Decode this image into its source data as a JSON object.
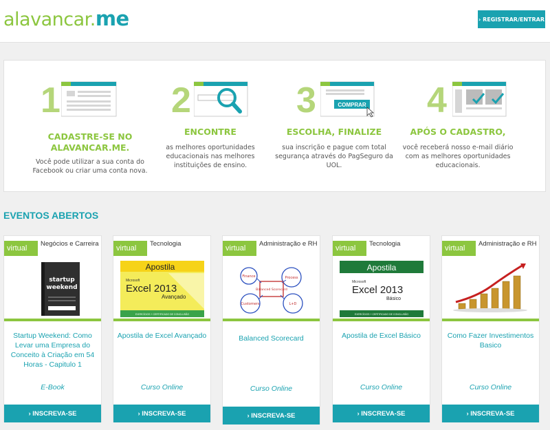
{
  "header": {
    "logo_part1": "alavancar.",
    "logo_part2": "me",
    "register_button": "› REGISTRAR/ENTRAR"
  },
  "steps": [
    {
      "number": "1",
      "title": "CADASTRE-SE NO ALAVANCAR.ME.",
      "description": "Você pode utilizar a sua conta do Facebook ou criar uma conta nova.",
      "icon": "form-icon"
    },
    {
      "number": "2",
      "title": "ENCONTRE",
      "description": "as melhores oportunidades educacionais nas melhores instituições de ensino.",
      "icon": "search-icon"
    },
    {
      "number": "3",
      "title": "ESCOLHA, FINALIZE",
      "description": "sua inscrição e pague com total segurança através do PagSeguro da UOL.",
      "icon": "buy-icon",
      "buy_label": "COMPRAR"
    },
    {
      "number": "4",
      "title": "APÓS O CADASTRO,",
      "description": "você receberá nosso e-mail diário com as melhores oportunidades educacionais.",
      "icon": "checklist-icon"
    }
  ],
  "section_title": "EVENTOS ABERTOS",
  "cards": [
    {
      "tag": "virtual",
      "category": "Negócios e Carreira",
      "title": "Startup Weekend: Como Levar uma Empresa do Conceito à Criação em 54 Horas - Capitulo 1",
      "type": "E-Book",
      "button": "› INSCREVA-SE",
      "thumb": "book-cover",
      "thumb_text": "startup weekend"
    },
    {
      "tag": "virtual",
      "category": "Tecnologia",
      "title": "Apostila de Excel Avançado",
      "type": "Curso Online",
      "button": "› INSCREVA-SE",
      "thumb": "excel-cover-yellow",
      "thumb_text": [
        "Apostila",
        "Microsoft",
        "Excel 2013",
        "Avançado",
        "EXERCÍCIOS + CERTIFICADO DE CONCLUSÃO"
      ]
    },
    {
      "tag": "virtual",
      "category": "Administração e RH",
      "title": "Balanced Scorecard",
      "type": "Curso Online",
      "button": "› INSCREVA-SE",
      "thumb": "scorecard-diagram",
      "thumb_text": [
        "Finance",
        "Process",
        "Balanced Scorecard",
        "Customers",
        "L+D"
      ]
    },
    {
      "tag": "virtual",
      "category": "Tecnologia",
      "title": "Apostila de Excel Básico",
      "type": "Curso Online",
      "button": "› INSCREVA-SE",
      "thumb": "excel-cover-green",
      "thumb_text": [
        "Apostila",
        "Microsoft",
        "Excel 2013",
        "Básico",
        "EXERCÍCIOS + CERTIFICADO DE CONCLUSÃO"
      ]
    },
    {
      "tag": "virtual",
      "category": "Administração e RH",
      "title": "Como Fazer Investimentos Basico",
      "type": "Curso Online",
      "button": "› INSCREVA-SE",
      "thumb": "coins-chart"
    }
  ],
  "colors": {
    "teal": "#1aa2b0",
    "green": "#8cc63f"
  }
}
